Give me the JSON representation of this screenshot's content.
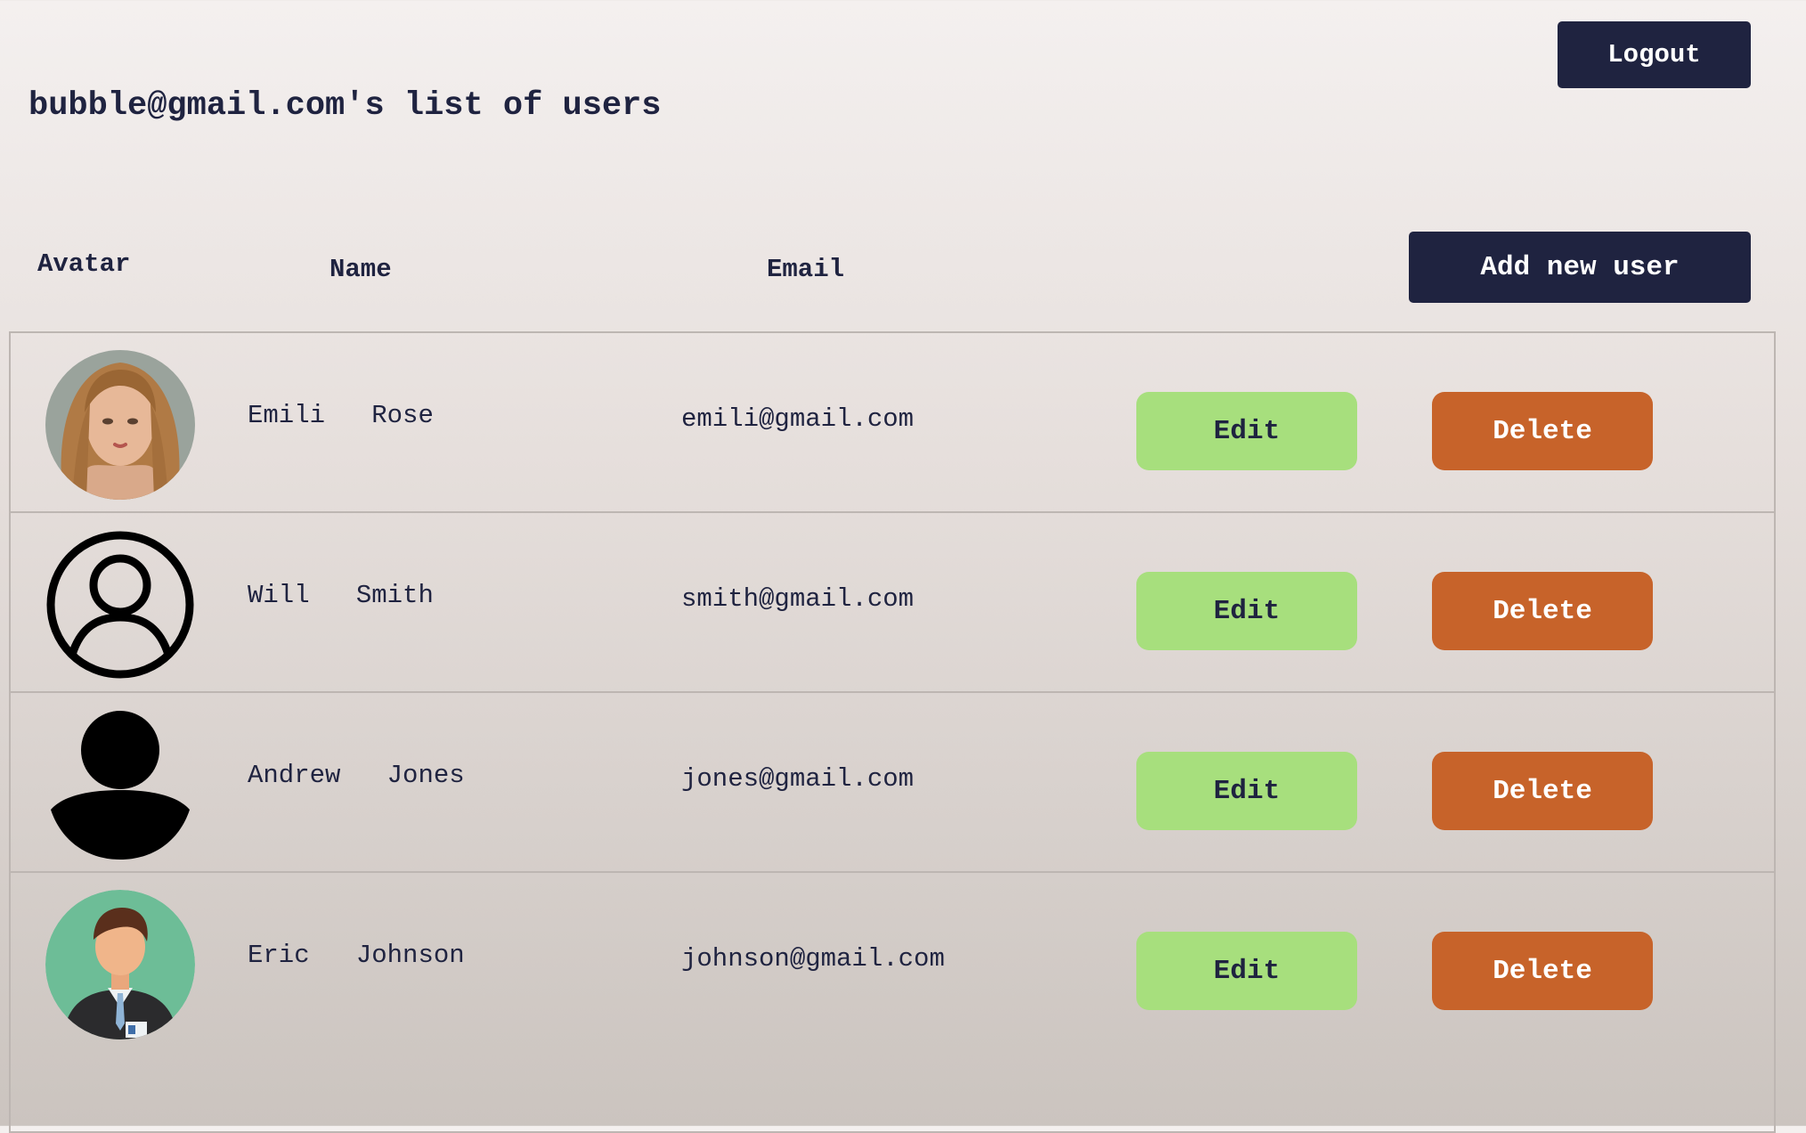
{
  "header": {
    "title": "bubble@gmail.com's list of users",
    "logout_label": "Logout",
    "add_user_label": "Add new user"
  },
  "table": {
    "columns": [
      "Avatar",
      "Name",
      "Email"
    ],
    "edit_label": "Edit",
    "delete_label": "Delete",
    "rows": [
      {
        "first": "Emili",
        "last": "Rose",
        "email": "emili@gmail.com",
        "avatar": "woman-photo-avatar"
      },
      {
        "first": "Will",
        "last": "Smith",
        "email": "smith@gmail.com",
        "avatar": "user-circle-outline-icon"
      },
      {
        "first": "Andrew",
        "last": "Jones",
        "email": "jones@gmail.com",
        "avatar": "user-silhouette-icon"
      },
      {
        "first": "Eric",
        "last": "Johnson",
        "email": "johnson@gmail.com",
        "avatar": "businessman-avatar"
      }
    ]
  },
  "colors": {
    "primary": "#1f2340",
    "edit": "#a7df7d",
    "delete": "#c7632a",
    "avatar_bg_green": "#6dbd97"
  }
}
